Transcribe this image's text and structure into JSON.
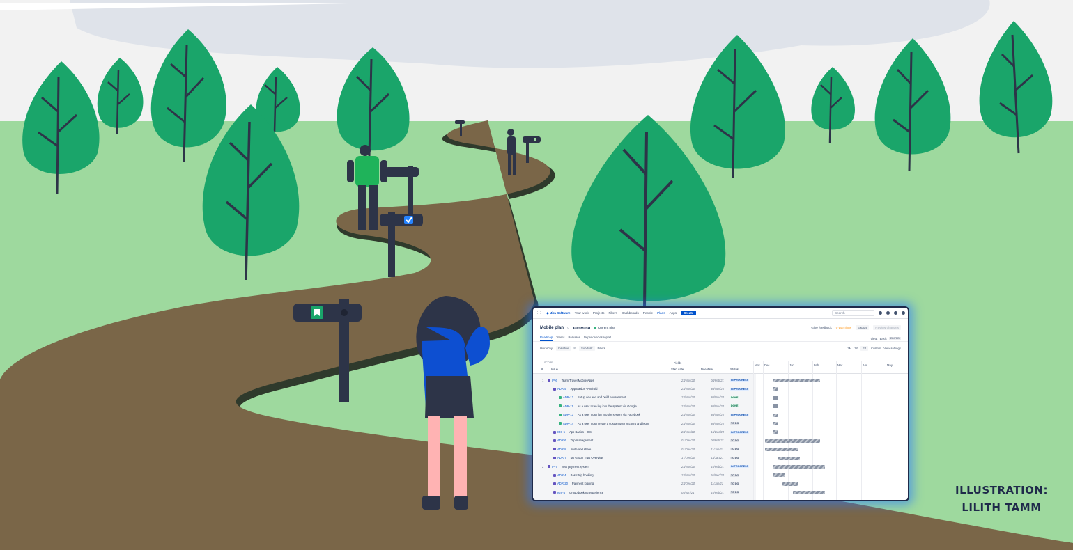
{
  "credit": {
    "line1": "ILLUSTRATION:",
    "line2": "LILITH TAMM"
  },
  "colors": {
    "sky": "#f2f2f2",
    "grass": "#9ed99e",
    "tree": "#1aa56a",
    "path": "#7a6648",
    "jira_blue": "#0052cc"
  },
  "jira": {
    "nav": {
      "product": "Jira Software",
      "items": [
        "Your work",
        "Projects",
        "Filters",
        "Dashboards",
        "People",
        "Plans",
        "Apps"
      ],
      "active_item": "Plans",
      "create": "Create",
      "search_placeholder": "Search"
    },
    "header": {
      "title": "Mobile plan",
      "readonly": "READ-ONLY",
      "current_plan": "Current plan",
      "give_feedback": "Give feedback",
      "warnings": "0 warnings",
      "export": "Export",
      "review": "Review changes"
    },
    "tabs": [
      "Roadmap",
      "Teams",
      "Releases",
      "Dependencies report"
    ],
    "views_label": "View:",
    "view_basic": "Basic",
    "view_edited": "EDITED",
    "filters": {
      "hierarchy": "Hierarchy:",
      "from": "Initiative",
      "to_label": "to",
      "to": "Sub-task",
      "filters": "Filters",
      "zooms": [
        "3M",
        "1Y",
        "Fit"
      ],
      "custom": "Custom",
      "view_settings": "View settings"
    },
    "columns": {
      "scope": "SCOPE",
      "hash": "#",
      "issue": "Issue",
      "fields": "Fields",
      "start": "Start date",
      "due": "Due date",
      "status": "Status"
    },
    "months": [
      "Nov",
      "Dec",
      "Jan",
      "Feb",
      "Mar",
      "Apr",
      "May"
    ],
    "rows": [
      {
        "num": "1",
        "key": "IP-6",
        "summary": "Team Travel Mobile Apps",
        "start": "23/Nov/20",
        "due": "08/Feb/21",
        "status": "IN PROGRESS",
        "st": "prog",
        "indent": 0,
        "color": "#6554c0"
      },
      {
        "num": "",
        "key": "ADR-5",
        "summary": "App Basics - Android",
        "start": "23/Nov/20",
        "due": "30/Nov/20",
        "status": "IN PROGRESS",
        "st": "prog",
        "indent": 1,
        "color": "#6554c0"
      },
      {
        "num": "",
        "key": "ADR-12",
        "summary": "Setup dev and and build environment",
        "start": "23/Nov/20",
        "due": "30/Nov/20",
        "status": "DONE",
        "st": "done",
        "indent": 2,
        "color": "#36b37e"
      },
      {
        "num": "",
        "key": "ADR-11",
        "summary": "As a user I can log into the system via Google",
        "start": "23/Nov/20",
        "due": "30/Nov/20",
        "status": "DONE",
        "st": "done",
        "indent": 2,
        "color": "#36b37e"
      },
      {
        "num": "",
        "key": "ADR-13",
        "summary": "As a user I can log into the system via Facebook",
        "start": "23/Nov/20",
        "due": "30/Nov/20",
        "status": "IN PROGRESS",
        "st": "prog",
        "indent": 2,
        "color": "#36b37e"
      },
      {
        "num": "",
        "key": "ADR-14",
        "summary": "As a user I can create a custom user account and login",
        "start": "23/Nov/20",
        "due": "30/Nov/20",
        "status": "TO DO",
        "st": "todo",
        "indent": 2,
        "color": "#36b37e"
      },
      {
        "num": "",
        "key": "IOS-5",
        "summary": "App Basics - IOS",
        "start": "23/Nov/20",
        "due": "16/Dec/20",
        "status": "IN PROGRESS",
        "st": "prog",
        "indent": 1,
        "color": "#6554c0"
      },
      {
        "num": "",
        "key": "ADR-6",
        "summary": "Trip management",
        "start": "01/Dec/20",
        "due": "08/Feb/21",
        "status": "TO DO",
        "st": "todo",
        "indent": 1,
        "color": "#6554c0"
      },
      {
        "num": "",
        "key": "ADR-8",
        "summary": "Invite and share",
        "start": "01/Dec/20",
        "due": "11/Jan/21",
        "status": "TO DO",
        "st": "todo",
        "indent": 1,
        "color": "#6554c0"
      },
      {
        "num": "",
        "key": "ADR-7",
        "summary": "My Group Trips Overview",
        "start": "17/Dec/20",
        "due": "13/Jan/21",
        "status": "TO DO",
        "st": "todo",
        "indent": 1,
        "color": "#6554c0"
      },
      {
        "num": "2",
        "key": "IP-7",
        "summary": "New payment system",
        "start": "23/Nov/20",
        "due": "14/Feb/21",
        "status": "IN PROGRESS",
        "st": "prog",
        "indent": 0,
        "color": "#6554c0"
      },
      {
        "num": "",
        "key": "ADR-4",
        "summary": "Basic trip booking",
        "start": "23/Nov/20",
        "due": "26/Dec/20",
        "status": "TO DO",
        "st": "todo",
        "indent": 1,
        "color": "#6554c0"
      },
      {
        "num": "",
        "key": "ADR-20",
        "summary": "Payment logging",
        "start": "23/Dec/20",
        "due": "11/Jan/21",
        "status": "TO DO",
        "st": "todo",
        "indent": 1,
        "color": "#6554c0"
      },
      {
        "num": "",
        "key": "IOS-4",
        "summary": "Group booking experience",
        "start": "04/Jan/21",
        "due": "14/Feb/21",
        "status": "TO DO",
        "st": "todo",
        "indent": 1,
        "color": "#6554c0"
      }
    ]
  }
}
